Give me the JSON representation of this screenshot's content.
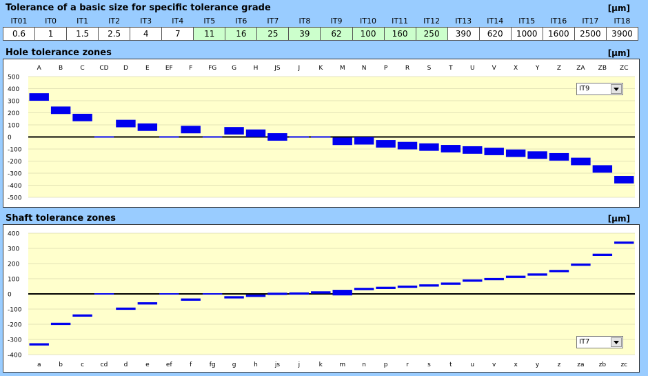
{
  "grades": {
    "title": "Tolerance of a basic size for specific tolerance grade",
    "unit": "[µm]",
    "headers": [
      "IT01",
      "IT0",
      "IT1",
      "IT2",
      "IT3",
      "IT4",
      "IT5",
      "IT6",
      "IT7",
      "IT8",
      "IT9",
      "IT10",
      "IT11",
      "IT12",
      "IT13",
      "IT14",
      "IT15",
      "IT16",
      "IT17",
      "IT18"
    ],
    "values": [
      "0.6",
      "1",
      "1.5",
      "2.5",
      "4",
      "7",
      "11",
      "16",
      "25",
      "39",
      "62",
      "100",
      "160",
      "250",
      "390",
      "620",
      "1000",
      "1600",
      "2500",
      "3900"
    ],
    "highlighted": [
      6,
      7,
      8,
      9,
      10,
      11,
      12,
      13
    ],
    "highlight_color": "#ccffcc"
  },
  "hole": {
    "title": "Hole tolerance zones",
    "unit": "[µm]",
    "selected_grade": "IT9"
  },
  "shaft": {
    "title": "Shaft tolerance zones",
    "unit": "[µm]",
    "selected_grade": "IT7"
  },
  "colors": {
    "bar": "#0000ee",
    "plot_bg": "#ffffcc",
    "page_bg": "#99ccff"
  },
  "chart_data": [
    {
      "type": "bar",
      "title": "Hole tolerance zones",
      "categories": [
        "A",
        "B",
        "C",
        "CD",
        "D",
        "E",
        "EF",
        "F",
        "FG",
        "G",
        "H",
        "JS",
        "J",
        "K",
        "M",
        "N",
        "P",
        "R",
        "S",
        "T",
        "U",
        "V",
        "X",
        "Y",
        "Z",
        "ZA",
        "ZB",
        "ZC"
      ],
      "ylim": [
        -500,
        500
      ],
      "yticks": [
        500,
        400,
        300,
        200,
        100,
        0,
        -100,
        -200,
        -300,
        -400,
        -500
      ],
      "grid": true,
      "ranges": [
        [
          300,
          362
        ],
        [
          190,
          252
        ],
        [
          130,
          192
        ],
        [
          0,
          0
        ],
        [
          80,
          142
        ],
        [
          50,
          112
        ],
        [
          0,
          0
        ],
        [
          30,
          92
        ],
        [
          0,
          0
        ],
        [
          20,
          82
        ],
        [
          0,
          62
        ],
        [
          -31,
          31
        ],
        [
          0,
          0
        ],
        [
          0,
          0
        ],
        [
          -67,
          -5
        ],
        [
          -63,
          -1
        ],
        [
          -88,
          -26
        ],
        [
          -103,
          -41
        ],
        [
          -115,
          -53
        ],
        [
          -128,
          -66
        ],
        [
          -139,
          -77
        ],
        [
          -151,
          -89
        ],
        [
          -166,
          -104
        ],
        [
          -181,
          -119
        ],
        [
          -196,
          -134
        ],
        [
          -234,
          -172
        ],
        [
          -296,
          -234
        ],
        [
          -385,
          -323
        ]
      ]
    },
    {
      "type": "bar",
      "title": "Shaft tolerance zones",
      "categories": [
        "a",
        "b",
        "c",
        "cd",
        "d",
        "e",
        "ef",
        "f",
        "fg",
        "g",
        "h",
        "js",
        "j",
        "k",
        "m",
        "n",
        "p",
        "r",
        "s",
        "t",
        "u",
        "v",
        "x",
        "y",
        "z",
        "za",
        "zb",
        "zc"
      ],
      "ylim": [
        -400,
        400
      ],
      "yticks": [
        400,
        300,
        200,
        100,
        0,
        -100,
        -200,
        -300,
        -400
      ],
      "grid": true,
      "ranges": [
        [
          -340,
          -325
        ],
        [
          -205,
          -190
        ],
        [
          -150,
          -135
        ],
        [
          0,
          0
        ],
        [
          -105,
          -90
        ],
        [
          -70,
          -55
        ],
        [
          0,
          0
        ],
        [
          -45,
          -30
        ],
        [
          0,
          0
        ],
        [
          -30,
          -15
        ],
        [
          -20,
          -5
        ],
        [
          -7,
          8
        ],
        [
          -5,
          10
        ],
        [
          2,
          17
        ],
        [
          -10,
          27
        ],
        [
          25,
          40
        ],
        [
          32,
          47
        ],
        [
          40,
          55
        ],
        [
          48,
          63
        ],
        [
          60,
          75
        ],
        [
          80,
          95
        ],
        [
          90,
          105
        ],
        [
          105,
          120
        ],
        [
          120,
          135
        ],
        [
          143,
          158
        ],
        [
          185,
          200
        ],
        [
          250,
          265
        ],
        [
          330,
          345
        ]
      ]
    }
  ]
}
